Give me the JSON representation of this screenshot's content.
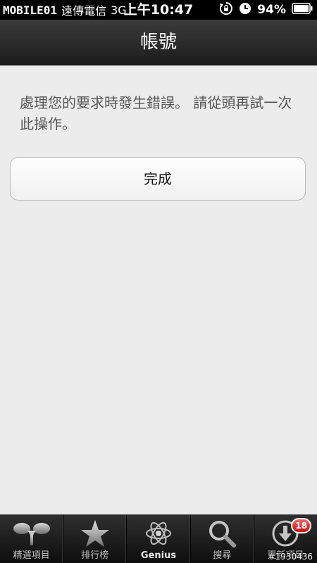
{
  "status_bar": {
    "watermark_logo": "MOBILE01",
    "carrier": "遠傳電信",
    "network": "3G",
    "time": "上午10:47",
    "battery": "94%"
  },
  "nav": {
    "title": "帳號"
  },
  "message": {
    "text": "處理您的要求時發生錯誤。 請從頭再試一次此操作。"
  },
  "done_button": {
    "label": "完成"
  },
  "tabs": [
    {
      "label": "精選項目",
      "icon": "featured-icon"
    },
    {
      "label": "排行榜",
      "icon": "star-icon"
    },
    {
      "label": "Genius",
      "icon": "atom-icon"
    },
    {
      "label": "搜尋",
      "icon": "search-icon"
    },
    {
      "label": "更新項目",
      "icon": "download-icon",
      "badge": "18"
    }
  ],
  "watermark_id": "#1930436",
  "colors": {
    "badge": "#d11a1a",
    "background": "#ececec",
    "nav": "#2a2a2a"
  }
}
